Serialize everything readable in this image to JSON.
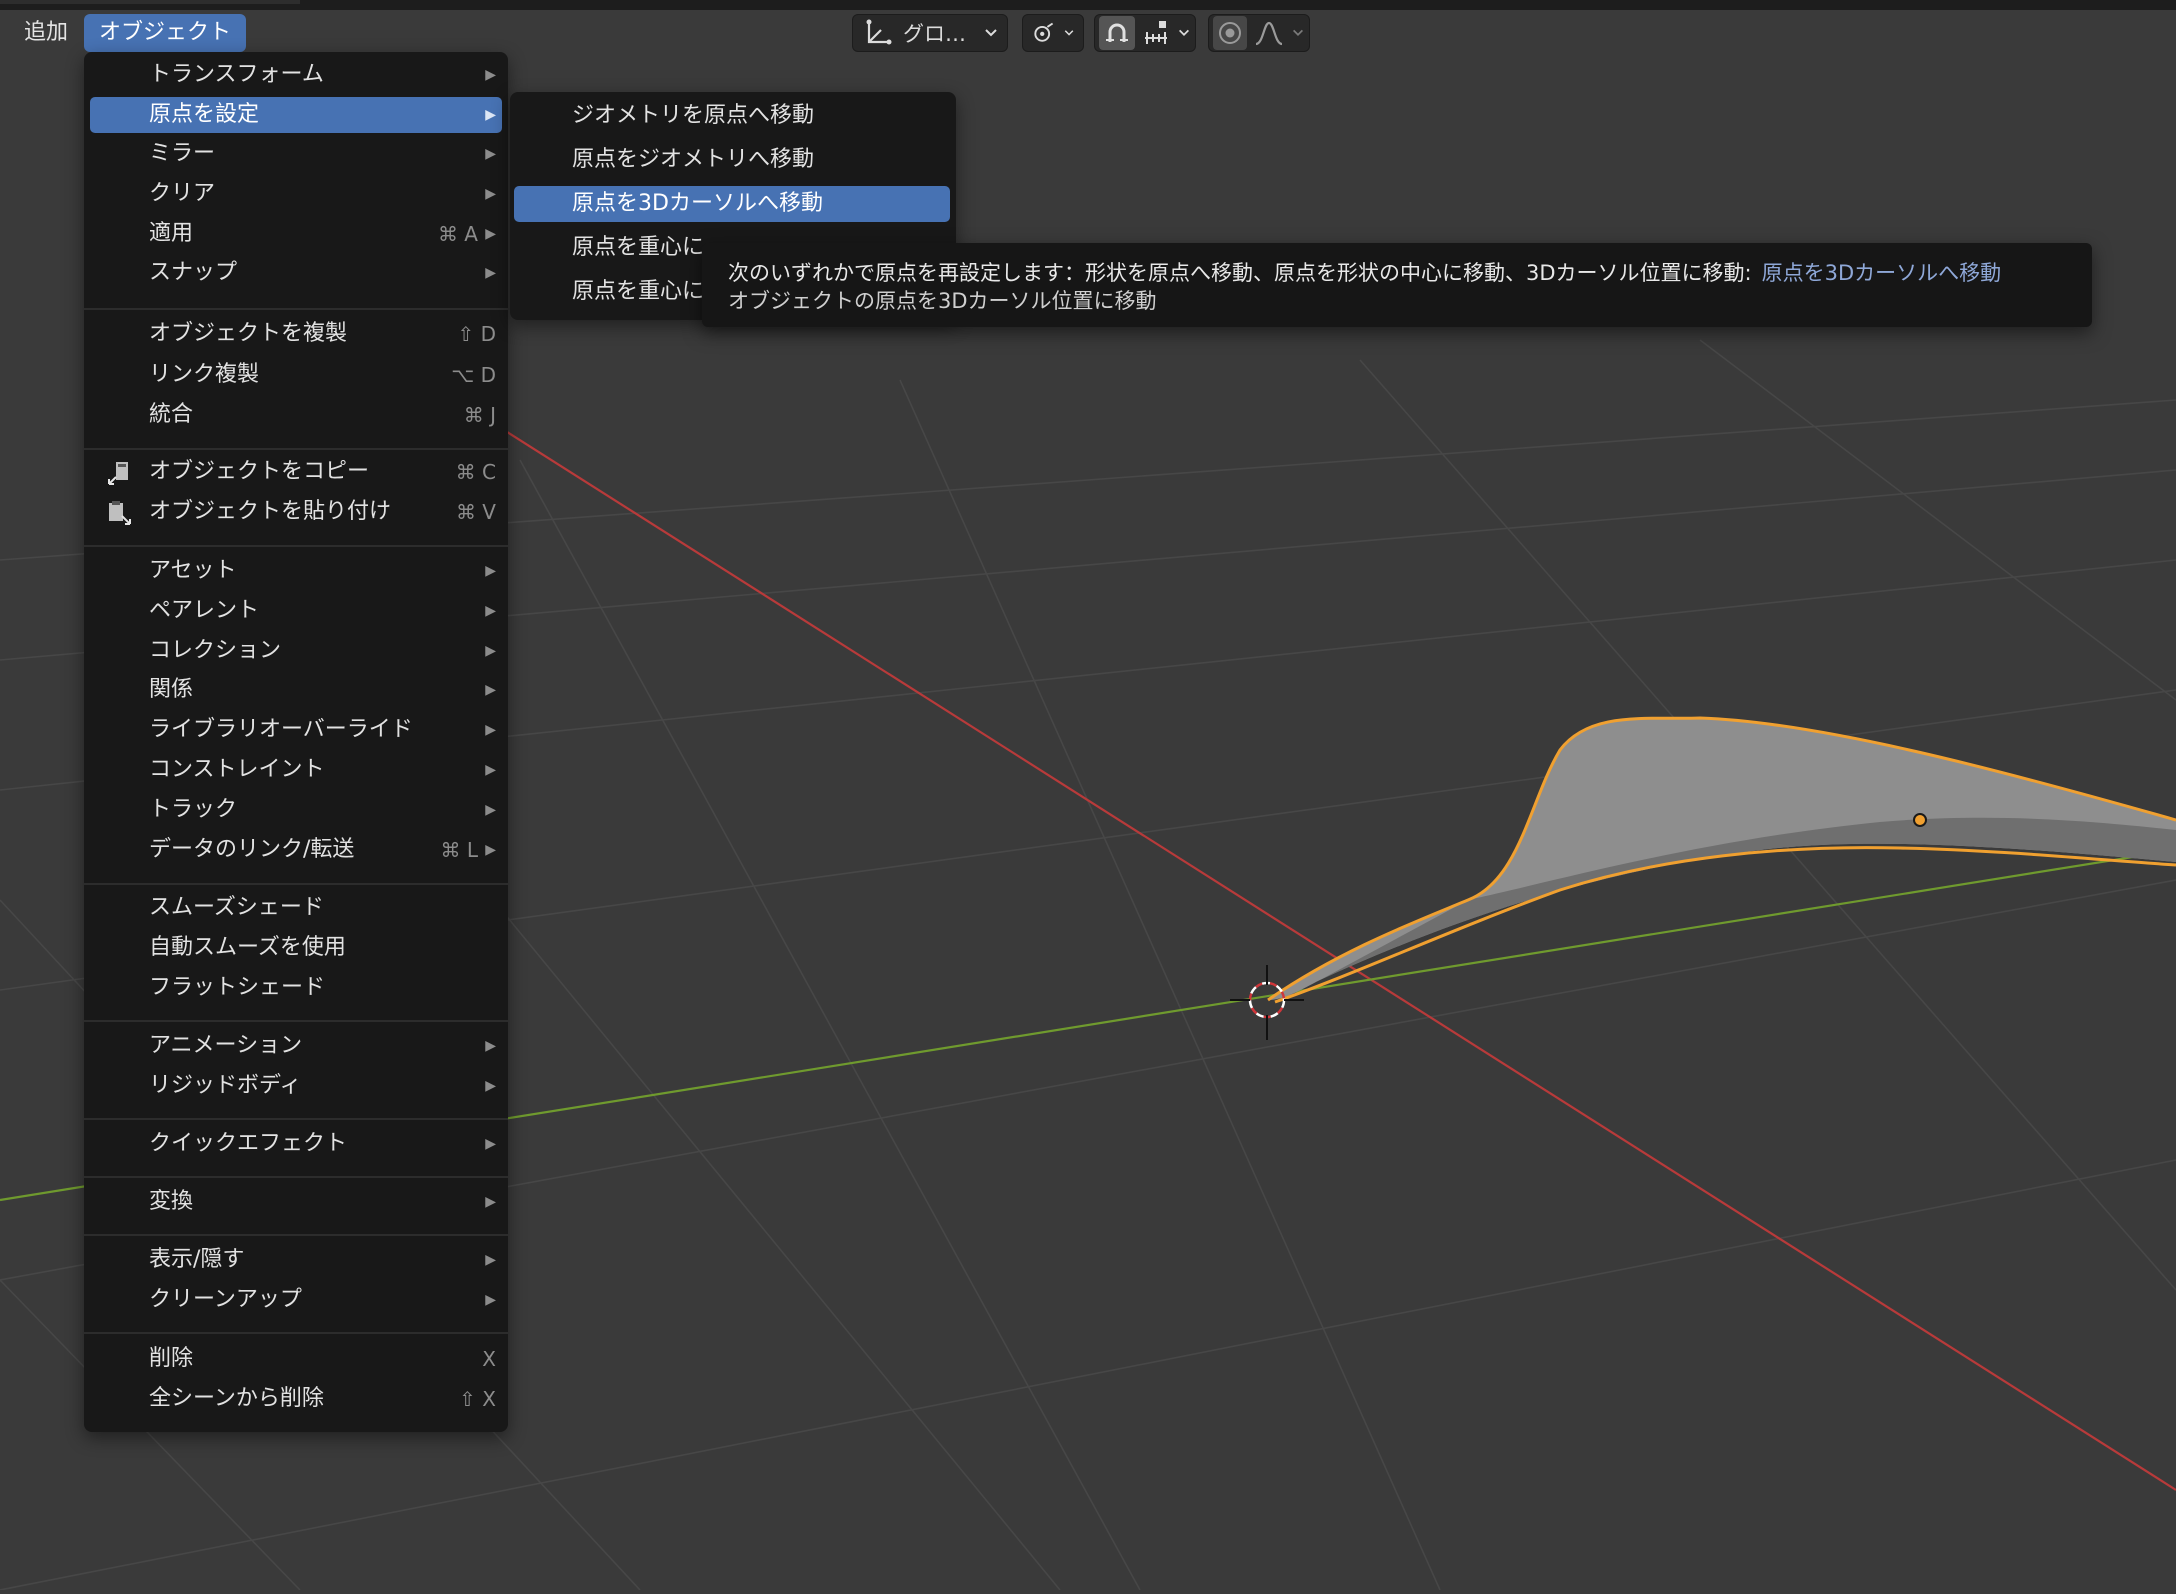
{
  "header": {
    "menus": [
      "追加",
      "オブジェクト"
    ],
    "transform_orientation": "グロ…"
  },
  "object_menu": {
    "items": [
      {
        "label": "トランスフォーム",
        "shortcut": "",
        "submenu": true
      },
      {
        "label": "原点を設定",
        "shortcut": "",
        "submenu": true,
        "highlighted": true
      },
      {
        "label": "ミラー",
        "shortcut": "",
        "submenu": true
      },
      {
        "label": "クリア",
        "shortcut": "",
        "submenu": true
      },
      {
        "label": "適用",
        "shortcut": "⌘ A",
        "submenu": true
      },
      {
        "label": "スナップ",
        "shortcut": "",
        "submenu": true
      },
      {
        "label": "オブジェクトを複製",
        "shortcut": "⇧ D",
        "submenu": false
      },
      {
        "label": "リンク複製",
        "shortcut": "⌥ D",
        "submenu": false
      },
      {
        "label": "統合",
        "shortcut": "⌘ J",
        "submenu": false
      },
      {
        "label": "オブジェクトをコピー",
        "shortcut": "⌘ C",
        "submenu": false,
        "icon": "copy-icon"
      },
      {
        "label": "オブジェクトを貼り付け",
        "shortcut": "⌘ V",
        "submenu": false,
        "icon": "paste-icon"
      },
      {
        "label": "アセット",
        "shortcut": "",
        "submenu": true
      },
      {
        "label": "ペアレント",
        "shortcut": "",
        "submenu": true
      },
      {
        "label": "コレクション",
        "shortcut": "",
        "submenu": true
      },
      {
        "label": "関係",
        "shortcut": "",
        "submenu": true
      },
      {
        "label": "ライブラリオーバーライド",
        "shortcut": "",
        "submenu": true
      },
      {
        "label": "コンストレイント",
        "shortcut": "",
        "submenu": true
      },
      {
        "label": "トラック",
        "shortcut": "",
        "submenu": true
      },
      {
        "label": "データのリンク/転送",
        "shortcut": "⌘ L",
        "submenu": true
      },
      {
        "label": "スムーズシェード",
        "shortcut": "",
        "submenu": false
      },
      {
        "label": "自動スムーズを使用",
        "shortcut": "",
        "submenu": false
      },
      {
        "label": "フラットシェード",
        "shortcut": "",
        "submenu": false
      },
      {
        "label": "アニメーション",
        "shortcut": "",
        "submenu": true
      },
      {
        "label": "リジッドボディ",
        "shortcut": "",
        "submenu": true
      },
      {
        "label": "クイックエフェクト",
        "shortcut": "",
        "submenu": true
      },
      {
        "label": "変換",
        "shortcut": "",
        "submenu": true
      },
      {
        "label": "表示/隠す",
        "shortcut": "",
        "submenu": true
      },
      {
        "label": "クリーンアップ",
        "shortcut": "",
        "submenu": true
      },
      {
        "label": "削除",
        "shortcut": "X",
        "submenu": false
      },
      {
        "label": "全シーンから削除",
        "shortcut": "⇧ X",
        "submenu": false
      }
    ]
  },
  "origin_submenu": {
    "items": [
      {
        "label": "ジオメトリを原点へ移動"
      },
      {
        "label": "原点をジオメトリへ移動"
      },
      {
        "label": "原点を3Dカーソルへ移動",
        "highlighted": true
      },
      {
        "label": "原点を重心に"
      },
      {
        "label": "原点を重心に"
      }
    ]
  },
  "tooltip": {
    "description": "次のいずれかで原点を再設定します：形状を原点へ移動、原点を形状の中心に移動、3Dカーソル位置に移動:",
    "operator": "原点を3Dカーソルへ移動",
    "detail": "オブジェクトの原点を3Dカーソル位置に移動"
  },
  "colors": {
    "accent": "#4772b3",
    "selection_outline": "#f0a030",
    "x_axis": "#b83a3a",
    "y_axis": "#6f9a2e",
    "viewport_bg": "#3a3a3a",
    "menu_bg": "#181818"
  }
}
